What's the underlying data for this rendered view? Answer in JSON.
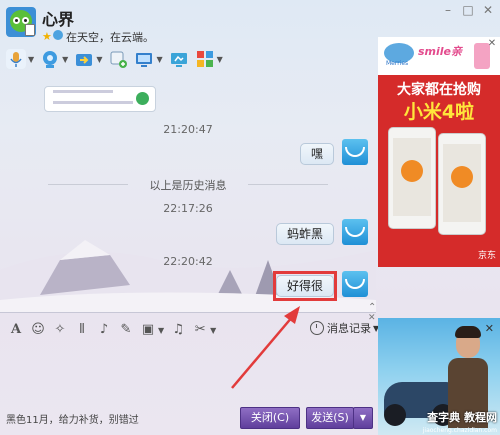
{
  "window": {
    "nickname": "心界",
    "signature": "在天空，在云端。"
  },
  "toolbar": {
    "icons": [
      "microphone-icon",
      "video-call-icon",
      "transfer-file-icon",
      "add-contact-icon",
      "remote-desktop-icon",
      "screen-share-icon",
      "apps-grid-icon"
    ]
  },
  "chat": {
    "history_divider": "以上是历史消息",
    "messages": [
      {
        "time": "21:20:47",
        "text": "嘿"
      },
      {
        "time": "22:17:26",
        "text": "蚂蚱黑"
      },
      {
        "time": "22:20:42",
        "text": "好得很"
      }
    ]
  },
  "editor": {
    "tools": [
      "font-icon",
      "emoji-icon",
      "magic-icon",
      "shake-icon",
      "voice-message-icon",
      "edit-icon",
      "image-icon",
      "music-icon",
      "screenshot-icon"
    ],
    "history_label": "消息记录"
  },
  "bottom": {
    "promo_text": "黑色11月，给力补货，别错过",
    "close_label": "关闭(C)",
    "send_label": "发送(S)"
  },
  "ads": {
    "top": {
      "brand": "Merries",
      "slogan": "smile亲",
      "headline": "大家都在抢购",
      "product": "小米4啦",
      "store": "京东"
    },
    "bottom": {
      "watermark": "查字典 教程网",
      "watermark_url": "jiaocheng.chazidian.com"
    }
  },
  "colors": {
    "button": "#6a48a8",
    "highlight": "#e23b3b",
    "ad_red": "#d52b2a"
  }
}
